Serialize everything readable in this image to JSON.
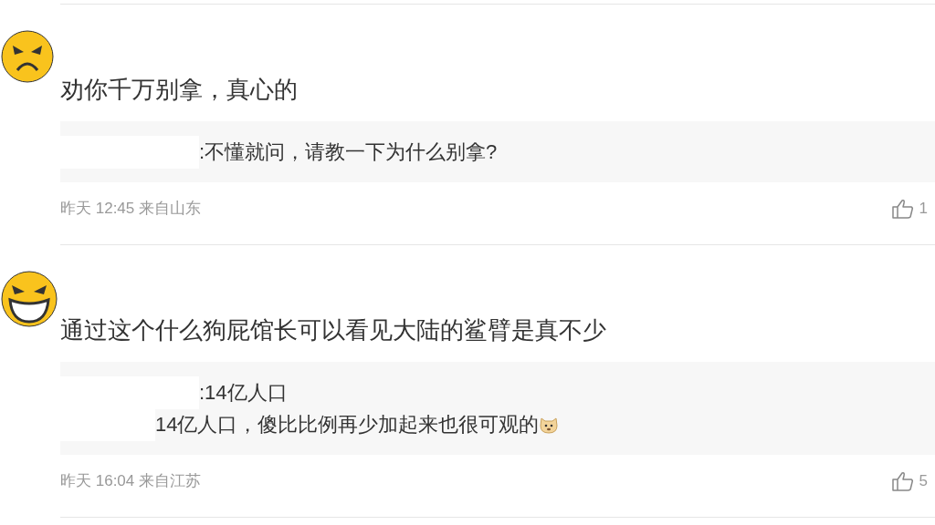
{
  "comments": [
    {
      "kind": "angry",
      "text": "劝你千万别拿，真心的",
      "reply_lines": [
        {
          "text": ":不懂就问，请教一下为什么别拿?",
          "emoji": false
        }
      ],
      "time": "昨天 12:45 来自山东",
      "likes": "1"
    },
    {
      "kind": "grin",
      "text": "通过这个什么狗屁馆长可以看见大陆的鲨臂是真不少",
      "reply_lines": [
        {
          "text": ":14亿人口",
          "emoji": false
        },
        {
          "text": "14亿人口，傻比比例再少加起来也很可观的",
          "emoji": true
        }
      ],
      "time": "昨天 16:04 来自江苏",
      "likes": "5"
    }
  ]
}
